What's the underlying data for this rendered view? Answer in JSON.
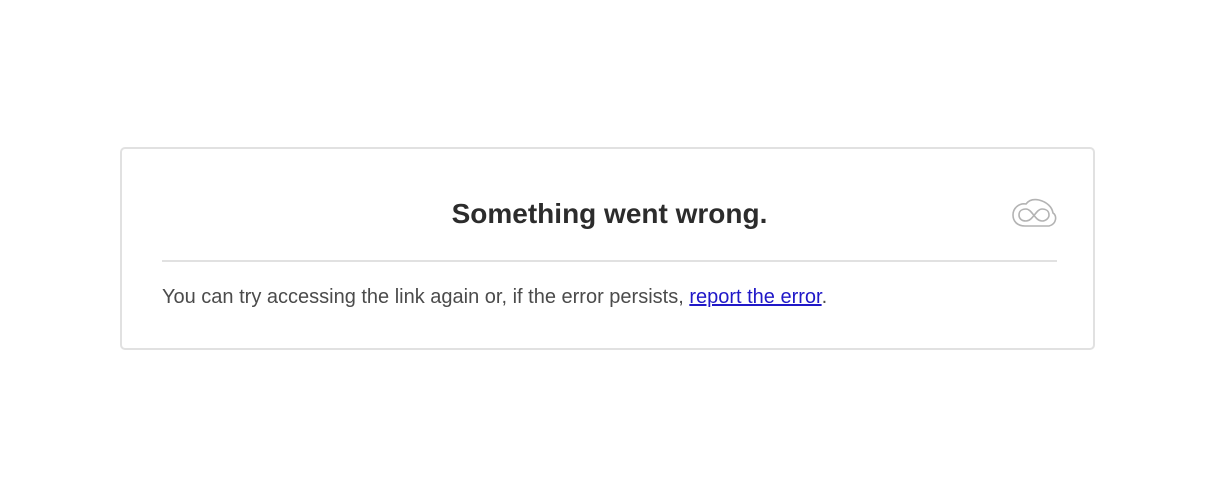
{
  "error_card": {
    "title": "Something went wrong.",
    "icon": "creative-cloud-icon",
    "message_before_link": "You can try accessing the link again or, if the error persists, ",
    "link_text": "report the error",
    "message_after_link": "."
  },
  "colors": {
    "link": "#2018c8",
    "title_text": "#2c2c2c",
    "body_text": "#4b4b4b",
    "border": "#e1e1e1",
    "icon_stroke": "#b3b3b3"
  }
}
